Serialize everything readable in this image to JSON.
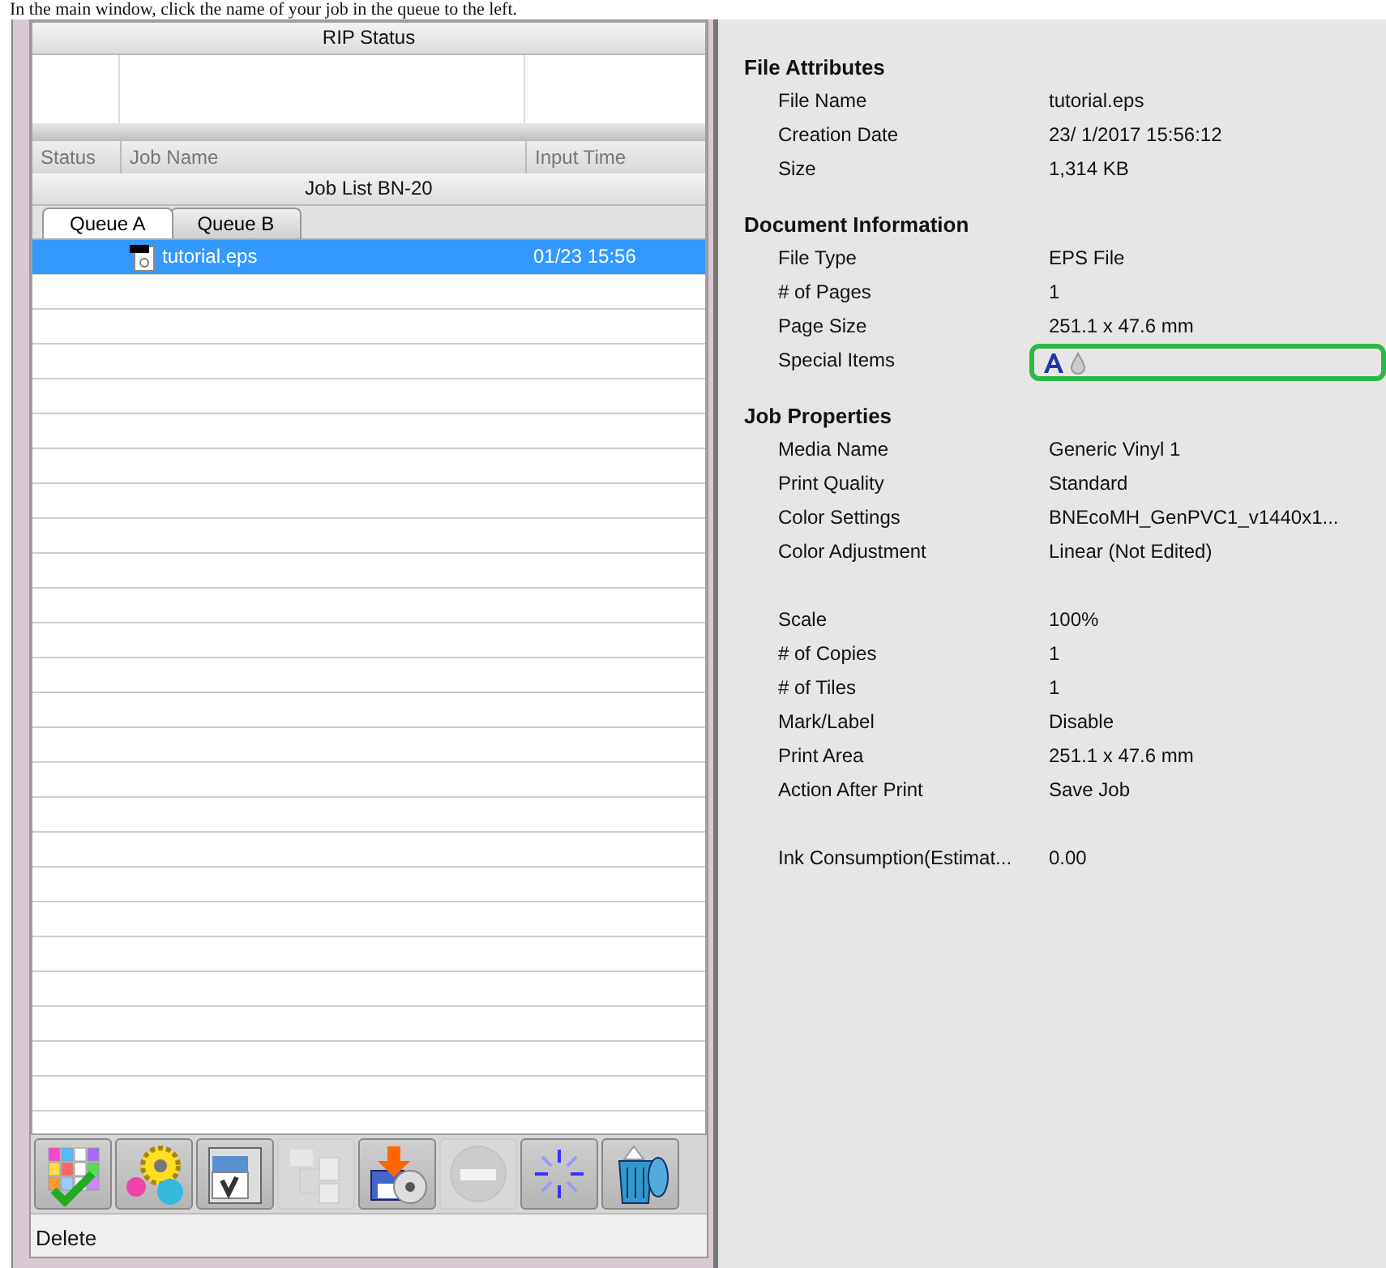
{
  "caption": "In the main window, click the name of your job in the queue to the left.",
  "rip_status": {
    "title": "RIP Status"
  },
  "job_list": {
    "columns": [
      "Status",
      "Job Name",
      "Input Time"
    ],
    "title": "Job List BN-20",
    "tabs": [
      {
        "label": "Queue A",
        "selected": true
      },
      {
        "label": "Queue B",
        "selected": false
      }
    ],
    "rows": [
      {
        "job_name": "tutorial.eps",
        "input_time": "01/23 15:56",
        "selected": true
      }
    ]
  },
  "toolbar": [
    {
      "kind": "palette",
      "disabled": false
    },
    {
      "kind": "gears",
      "disabled": false
    },
    {
      "kind": "printer",
      "disabled": false
    },
    {
      "kind": "tree",
      "disabled": true
    },
    {
      "kind": "save",
      "disabled": false
    },
    {
      "kind": "stop",
      "disabled": true
    },
    {
      "kind": "spinner",
      "disabled": false
    },
    {
      "kind": "trash",
      "disabled": false
    }
  ],
  "status_bar": "Delete",
  "properties": {
    "sections": [
      {
        "title": "File Attributes",
        "groups": [
          [
            {
              "label": "File Name",
              "value": "tutorial.eps"
            },
            {
              "label": "Creation Date",
              "value": "23/ 1/2017 15:56:12"
            },
            {
              "label": "Size",
              "value": "1,314 KB"
            }
          ]
        ]
      },
      {
        "title": "Document Information",
        "groups": [
          [
            {
              "label": "File Type",
              "value": "EPS File"
            },
            {
              "label": "# of Pages",
              "value": "1"
            },
            {
              "label": "Page Size",
              "value": "251.1 x 47.6 mm"
            },
            {
              "label": "Special Items",
              "kind": "icons"
            }
          ]
        ]
      },
      {
        "title": "Job Properties",
        "groups": [
          [
            {
              "label": "Media Name",
              "value": "Generic Vinyl 1"
            },
            {
              "label": "Print Quality",
              "value": "Standard"
            },
            {
              "label": "Color Settings",
              "value": "BNEcoMH_GenPVC1_v1440x1..."
            },
            {
              "label": "Color Adjustment",
              "value": "Linear (Not Edited)"
            }
          ],
          [
            {
              "label": "Scale",
              "value": "100%"
            },
            {
              "label": "# of Copies",
              "value": "1"
            },
            {
              "label": "# of Tiles",
              "value": "1"
            },
            {
              "label": "Mark/Label",
              "value": "Disable"
            },
            {
              "label": "Print Area",
              "value": "251.1 x 47.6 mm"
            },
            {
              "label": "Action After Print",
              "value": "Save Job"
            }
          ],
          [
            {
              "label": "Ink Consumption(Estimat...",
              "value": "0.00"
            }
          ]
        ]
      }
    ]
  }
}
